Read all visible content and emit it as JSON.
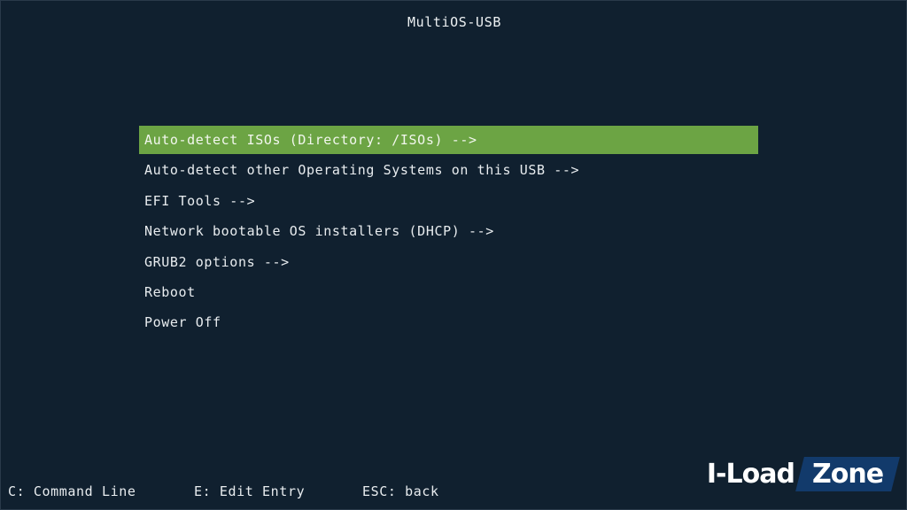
{
  "title": "MultiOS-USB",
  "menu": {
    "items": [
      {
        "label": "Auto-detect ISOs (Directory: /ISOs) -->",
        "selected": true
      },
      {
        "label": "Auto-detect other Operating Systems on this USB -->",
        "selected": false
      },
      {
        "label": "EFI Tools -->",
        "selected": false
      },
      {
        "label": "Network bootable OS installers (DHCP) -->",
        "selected": false
      },
      {
        "label": "GRUB2 options -->",
        "selected": false
      },
      {
        "label": "Reboot",
        "selected": false
      },
      {
        "label": "Power Off",
        "selected": false
      }
    ]
  },
  "footer": {
    "command_line": "C: Command Line",
    "edit_entry": "E: Edit Entry",
    "back": "ESC: back"
  },
  "watermark": {
    "part1": "I-Load",
    "part2": "Zone"
  },
  "colors": {
    "background": "#10202f",
    "highlight": "#6ca444",
    "text": "#e8ecef"
  }
}
